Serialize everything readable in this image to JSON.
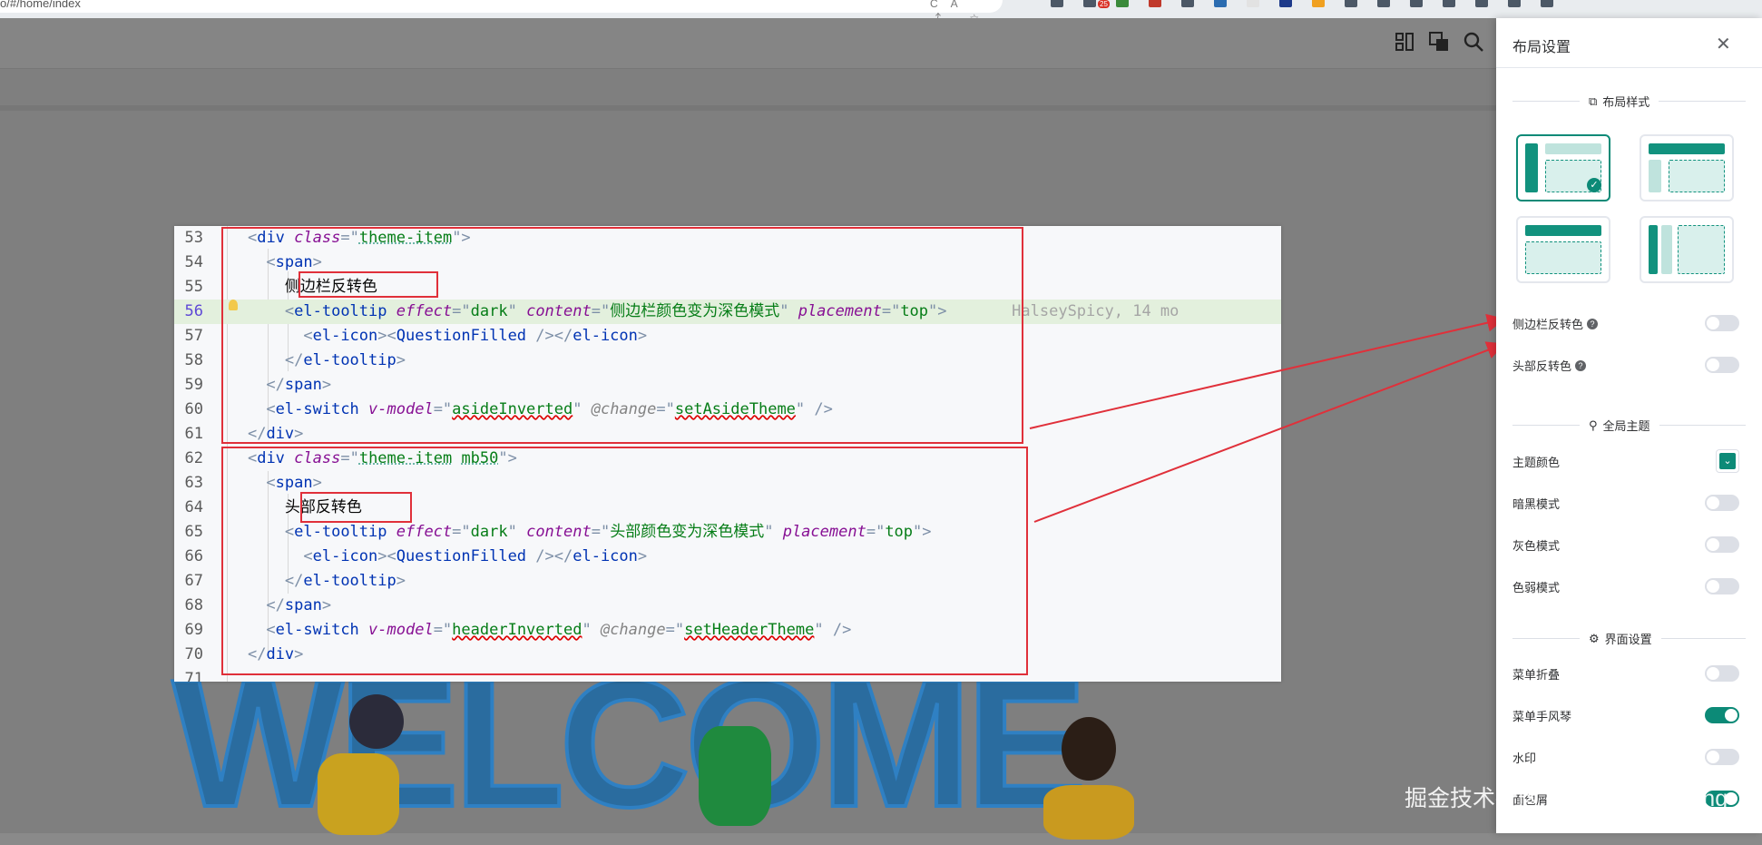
{
  "browser": {
    "url": "o/#/home/index",
    "actions": "CA ⤴ ☆",
    "badge": "25"
  },
  "code": {
    "lines": [
      {
        "n": "53",
        "indent": "    ",
        "parts": [
          [
            "t-br",
            "<"
          ],
          [
            "t-tag",
            "div "
          ],
          [
            "t-attr",
            "class"
          ],
          [
            "t-br",
            "=\""
          ],
          [
            "t-str t-warn2",
            "theme-item"
          ],
          [
            "t-br",
            "\">"
          ]
        ]
      },
      {
        "n": "54",
        "indent": "      ",
        "parts": [
          [
            "t-br",
            "<"
          ],
          [
            "t-tag",
            "span"
          ],
          [
            "t-br",
            ">"
          ]
        ]
      },
      {
        "n": "55",
        "indent": "        ",
        "parts": [
          [
            "t-txt",
            "侧边栏反转色"
          ]
        ]
      },
      {
        "n": "56",
        "indent": "        ",
        "parts": [
          [
            "t-br",
            "<"
          ],
          [
            "t-tag",
            "el-tooltip "
          ],
          [
            "t-attr",
            "effect"
          ],
          [
            "t-br",
            "=\""
          ],
          [
            "t-str",
            "dark"
          ],
          [
            "t-br",
            "\" "
          ],
          [
            "t-attr",
            "content"
          ],
          [
            "t-br",
            "=\""
          ],
          [
            "t-str",
            "侧边栏颜色变为深色模式"
          ],
          [
            "t-br",
            "\" "
          ],
          [
            "t-attr",
            "placement"
          ],
          [
            "t-br",
            "=\""
          ],
          [
            "t-str",
            "top"
          ],
          [
            "t-br",
            "\">"
          ],
          [
            "t-hint",
            "       HalseySpicy, 14 mo"
          ]
        ]
      },
      {
        "n": "57",
        "indent": "          ",
        "parts": [
          [
            "t-br",
            "<"
          ],
          [
            "t-tag",
            "el-icon"
          ],
          [
            "t-br",
            "><"
          ],
          [
            "t-tag",
            "QuestionFilled "
          ],
          [
            "t-br",
            "/></"
          ],
          [
            "t-tag",
            "el-icon"
          ],
          [
            "t-br",
            ">"
          ]
        ]
      },
      {
        "n": "58",
        "indent": "        ",
        "parts": [
          [
            "t-br",
            "</"
          ],
          [
            "t-tag",
            "el-tooltip"
          ],
          [
            "t-br",
            ">"
          ]
        ]
      },
      {
        "n": "59",
        "indent": "      ",
        "parts": [
          [
            "t-br",
            "</"
          ],
          [
            "t-tag",
            "span"
          ],
          [
            "t-br",
            ">"
          ]
        ]
      },
      {
        "n": "60",
        "indent": "      ",
        "parts": [
          [
            "t-br",
            "<"
          ],
          [
            "t-tag",
            "el-switch "
          ],
          [
            "t-attr",
            "v-model"
          ],
          [
            "t-br",
            "=\""
          ],
          [
            "t-str t-warn",
            "asideInverted"
          ],
          [
            "t-br",
            "\" "
          ],
          [
            "t-attr2",
            "@change"
          ],
          [
            "t-br",
            "=\""
          ],
          [
            "t-str t-warn",
            "setAsideTheme"
          ],
          [
            "t-br",
            "\" />"
          ]
        ]
      },
      {
        "n": "61",
        "indent": "    ",
        "parts": [
          [
            "t-br",
            "</"
          ],
          [
            "t-tag",
            "div"
          ],
          [
            "t-br",
            ">"
          ]
        ]
      },
      {
        "n": "62",
        "indent": "    ",
        "parts": [
          [
            "t-br",
            "<"
          ],
          [
            "t-tag",
            "div "
          ],
          [
            "t-attr",
            "class"
          ],
          [
            "t-br",
            "=\""
          ],
          [
            "t-str t-warn2",
            "theme-item"
          ],
          [
            "t-str",
            " "
          ],
          [
            "t-str t-warn2",
            "mb50"
          ],
          [
            "t-br",
            "\">"
          ]
        ]
      },
      {
        "n": "63",
        "indent": "      ",
        "parts": [
          [
            "t-br",
            "<"
          ],
          [
            "t-tag",
            "span"
          ],
          [
            "t-br",
            ">"
          ]
        ]
      },
      {
        "n": "64",
        "indent": "        ",
        "parts": [
          [
            "t-txt",
            "头部反转色"
          ]
        ]
      },
      {
        "n": "65",
        "indent": "        ",
        "parts": [
          [
            "t-br",
            "<"
          ],
          [
            "t-tag",
            "el-tooltip "
          ],
          [
            "t-attr",
            "effect"
          ],
          [
            "t-br",
            "=\""
          ],
          [
            "t-str",
            "dark"
          ],
          [
            "t-br",
            "\" "
          ],
          [
            "t-attr",
            "content"
          ],
          [
            "t-br",
            "=\""
          ],
          [
            "t-str",
            "头部颜色变为深色模式"
          ],
          [
            "t-br",
            "\" "
          ],
          [
            "t-attr",
            "placement"
          ],
          [
            "t-br",
            "=\""
          ],
          [
            "t-str",
            "top"
          ],
          [
            "t-br",
            "\">"
          ]
        ]
      },
      {
        "n": "66",
        "indent": "          ",
        "parts": [
          [
            "t-br",
            "<"
          ],
          [
            "t-tag",
            "el-icon"
          ],
          [
            "t-br",
            "><"
          ],
          [
            "t-tag",
            "QuestionFilled "
          ],
          [
            "t-br",
            "/></"
          ],
          [
            "t-tag",
            "el-icon"
          ],
          [
            "t-br",
            ">"
          ]
        ]
      },
      {
        "n": "67",
        "indent": "        ",
        "parts": [
          [
            "t-br",
            "</"
          ],
          [
            "t-tag",
            "el-tooltip"
          ],
          [
            "t-br",
            ">"
          ]
        ]
      },
      {
        "n": "68",
        "indent": "      ",
        "parts": [
          [
            "t-br",
            "</"
          ],
          [
            "t-tag",
            "span"
          ],
          [
            "t-br",
            ">"
          ]
        ]
      },
      {
        "n": "69",
        "indent": "      ",
        "parts": [
          [
            "t-br",
            "<"
          ],
          [
            "t-tag",
            "el-switch "
          ],
          [
            "t-attr",
            "v-model"
          ],
          [
            "t-br",
            "=\""
          ],
          [
            "t-str t-warn",
            "headerInverted"
          ],
          [
            "t-br",
            "\" "
          ],
          [
            "t-attr2",
            "@change"
          ],
          [
            "t-br",
            "=\""
          ],
          [
            "t-str t-warn",
            "setHeaderTheme"
          ],
          [
            "t-br",
            "\" />"
          ]
        ]
      },
      {
        "n": "70",
        "indent": "    ",
        "parts": [
          [
            "t-br",
            "</"
          ],
          [
            "t-tag",
            "div"
          ],
          [
            "t-br",
            ">"
          ]
        ]
      },
      {
        "n": "71",
        "indent": "",
        "parts": []
      }
    ],
    "active_line": "56"
  },
  "background": {
    "welcome_text": "WELCOME"
  },
  "drawer": {
    "title": "布局设置",
    "close": "✕",
    "section_layout": "布局样式",
    "section_theme": "全局主题",
    "section_ui": "界面设置",
    "settings": [
      {
        "label": "侧边栏反转色",
        "help": true,
        "on": false
      },
      {
        "label": "头部反转色",
        "help": true,
        "on": false
      }
    ],
    "theme": {
      "primary_label": "主题颜色",
      "primary_color": "#0c8a77",
      "dark_label": "暗黑模式",
      "grey_label": "灰色模式",
      "weak_label": "色弱模式"
    },
    "ui": {
      "collapse_label": "菜单折叠",
      "accordion_label": "菜单手风琴",
      "watermark_label": "水印",
      "breadcrumb_label": "面包屑"
    }
  },
  "watermark": "掘金技术社区 @ Abadbeginning"
}
